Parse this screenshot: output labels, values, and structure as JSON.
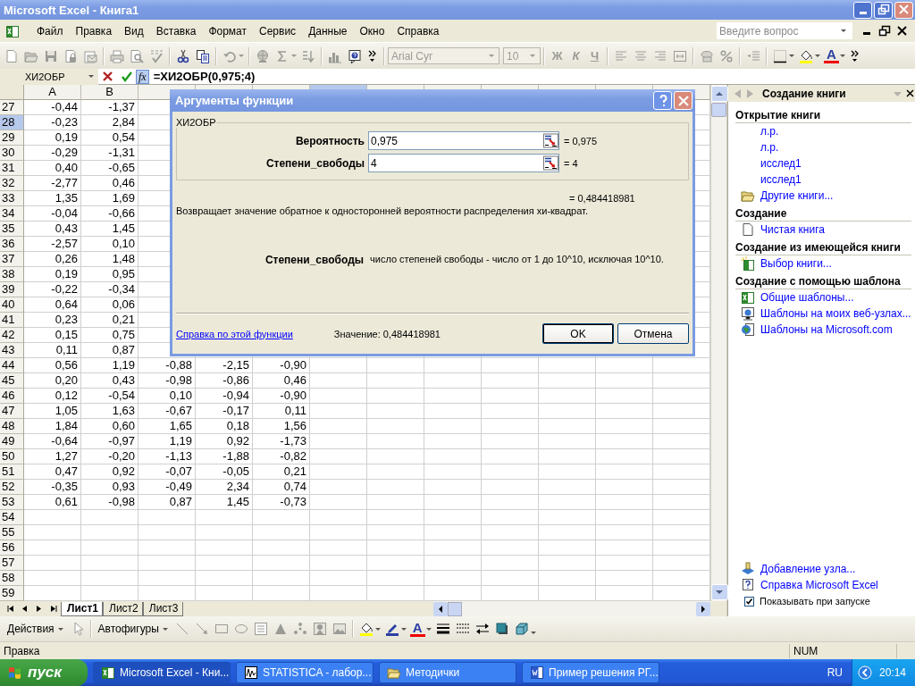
{
  "window": {
    "title": "Microsoft Excel - Книга1"
  },
  "menu": [
    "Файл",
    "Правка",
    "Вид",
    "Вставка",
    "Формат",
    "Сервис",
    "Данные",
    "Окно",
    "Справка"
  ],
  "help_search": {
    "placeholder": "Введите вопрос"
  },
  "formatting": {
    "font": "Arial Cyr",
    "size": "10",
    "style_buttons": [
      "Ж",
      "К",
      "Ч"
    ],
    "font_color": "A"
  },
  "formula_bar": {
    "name_box": "ХИ2ОБР",
    "function_button": "fx",
    "formula": "=ХИ2ОБР(0,975;4)"
  },
  "grid": {
    "columns": [
      {
        "label": "A",
        "selected": false
      },
      {
        "label": "B",
        "selected": false
      },
      {
        "selected": false
      },
      {
        "selected": false
      },
      {
        "selected": false
      },
      {
        "selected": true
      },
      {
        "selected": false
      },
      {
        "selected": false
      },
      {
        "selected": false
      },
      {
        "selected": false
      },
      {
        "selected": false
      },
      {
        "selected": false
      }
    ],
    "rows": [
      {
        "number": "27",
        "selected": false,
        "cells": [
          "-0,44",
          "-1,37"
        ]
      },
      {
        "number": "28",
        "selected": true,
        "cells": [
          "-0,23",
          "2,84"
        ]
      },
      {
        "number": "29",
        "selected": false,
        "cells": [
          "0,19",
          "0,54"
        ]
      },
      {
        "number": "30",
        "selected": false,
        "cells": [
          "-0,29",
          "-1,31"
        ]
      },
      {
        "number": "31",
        "selected": false,
        "cells": [
          "0,40",
          "-0,65"
        ]
      },
      {
        "number": "32",
        "selected": false,
        "cells": [
          "-2,77",
          "0,46"
        ]
      },
      {
        "number": "33",
        "selected": false,
        "cells": [
          "1,35",
          "1,69"
        ]
      },
      {
        "number": "34",
        "selected": false,
        "cells": [
          "-0,04",
          "-0,66"
        ]
      },
      {
        "number": "35",
        "selected": false,
        "cells": [
          "0,43",
          "1,45"
        ]
      },
      {
        "number": "36",
        "selected": false,
        "cells": [
          "-2,57",
          "0,10"
        ]
      },
      {
        "number": "37",
        "selected": false,
        "cells": [
          "0,26",
          "1,48"
        ]
      },
      {
        "number": "38",
        "selected": false,
        "cells": [
          "0,19",
          "0,95"
        ]
      },
      {
        "number": "39",
        "selected": false,
        "cells": [
          "-0,22",
          "-0,34"
        ]
      },
      {
        "number": "40",
        "selected": false,
        "cells": [
          "0,64",
          "0,06"
        ]
      },
      {
        "number": "41",
        "selected": false,
        "cells": [
          "0,23",
          "0,21"
        ]
      },
      {
        "number": "42",
        "selected": false,
        "cells": [
          "0,15",
          "0,75"
        ]
      },
      {
        "number": "43",
        "selected": false,
        "cells": [
          "0,11",
          "0,87"
        ]
      },
      {
        "number": "44",
        "selected": false,
        "cells": [
          "0,56",
          "1,19",
          "-0,88",
          "-2,15",
          "-0,90"
        ]
      },
      {
        "number": "45",
        "selected": false,
        "cells": [
          "0,20",
          "0,43",
          "-0,98",
          "-0,86",
          "0,46"
        ]
      },
      {
        "number": "46",
        "selected": false,
        "cells": [
          "0,12",
          "-0,54",
          "0,10",
          "-0,94",
          "-0,90"
        ]
      },
      {
        "number": "47",
        "selected": false,
        "cells": [
          "1,05",
          "1,63",
          "-0,67",
          "-0,17",
          "0,11"
        ]
      },
      {
        "number": "48",
        "selected": false,
        "cells": [
          "1,84",
          "0,60",
          "1,65",
          "0,18",
          "1,56"
        ]
      },
      {
        "number": "49",
        "selected": false,
        "cells": [
          "-0,64",
          "-0,97",
          "1,19",
          "0,92",
          "-1,73"
        ]
      },
      {
        "number": "50",
        "selected": false,
        "cells": [
          "1,27",
          "-0,20",
          "-1,13",
          "-1,88",
          "-0,82"
        ]
      },
      {
        "number": "51",
        "selected": false,
        "cells": [
          "0,47",
          "0,92",
          "-0,07",
          "-0,05",
          "0,21"
        ]
      },
      {
        "number": "52",
        "selected": false,
        "cells": [
          "-0,35",
          "0,93",
          "-0,49",
          "2,34",
          "0,74"
        ]
      },
      {
        "number": "53",
        "selected": false,
        "cells": [
          "0,61",
          "-0,98",
          "0,87",
          "1,45",
          "-0,73"
        ]
      },
      {
        "number": "54",
        "selected": false,
        "cells": []
      },
      {
        "number": "55",
        "selected": false,
        "cells": []
      },
      {
        "number": "56",
        "selected": false,
        "cells": []
      },
      {
        "number": "57",
        "selected": false,
        "cells": []
      },
      {
        "number": "58",
        "selected": false,
        "cells": []
      },
      {
        "number": "59",
        "selected": false,
        "cells": []
      }
    ]
  },
  "dialog": {
    "title": "Аргументы функции",
    "group": "ХИ2ОБР",
    "arguments": [
      {
        "label": "Вероятность",
        "value": "0,975",
        "result": "= 0,975"
      },
      {
        "label": "Степени_свободы",
        "value": "4",
        "result": "= 4"
      }
    ],
    "result": "= 0,484418981",
    "description": "Возвращает значение обратное к односторонней вероятности распределения хи-квадрат.",
    "argument_help": {
      "label": "Степени_свободы",
      "text": "число степеней свободы - число от 1 до 10^10, исключая 10^10."
    },
    "help_link": "Справка по этой функции",
    "value": "Значение: 0,484418981",
    "buttons": [
      "OK",
      "Отмена"
    ]
  },
  "task_pane": {
    "title": "Создание книги",
    "sections": [
      {
        "heading": "Открытие книги",
        "items": [
          {
            "label": "л.р.",
            "kind": "recent"
          },
          {
            "label": "л.р.",
            "kind": "recent"
          },
          {
            "label": "исслед1",
            "kind": "recent"
          },
          {
            "label": "исслед1",
            "kind": "recent"
          },
          {
            "label": "Другие книги...",
            "kind": "folder"
          }
        ]
      },
      {
        "heading": "Создание",
        "items": [
          {
            "label": "Чистая книга",
            "kind": "blank"
          }
        ]
      },
      {
        "heading": "Создание из имеющейся книги",
        "items": [
          {
            "label": "Выбор книги...",
            "kind": "workbook"
          }
        ]
      },
      {
        "heading": "Создание с помощью шаблона",
        "items": [
          {
            "label": "Общие шаблоны...",
            "kind": "template"
          },
          {
            "label": "Шаблоны на моих веб-узлах...",
            "kind": "web"
          },
          {
            "label": "Шаблоны на Microsoft.com",
            "kind": "globe"
          }
        ]
      }
    ],
    "footer": [
      {
        "label": "Добавление узла...",
        "kind": "site"
      },
      {
        "label": "Справка Microsoft Excel",
        "kind": "help"
      }
    ],
    "show_at_startup": {
      "label": "Показывать при запуске",
      "checked": true
    }
  },
  "sheet_tabs": [
    {
      "label": "Лист1",
      "selected": true
    },
    {
      "label": "Лист2",
      "selected": false
    },
    {
      "label": "Лист3",
      "selected": false
    }
  ],
  "drawing_toolbar": {
    "actions": "Действия",
    "autoshapes": "Автофигуры",
    "font_color": "A"
  },
  "status_bar": {
    "mode": "Правка",
    "indicator": "NUM"
  },
  "taskbar": {
    "start": "пуск",
    "tasks": [
      {
        "label": "Microsoft Excel - Кни...",
        "kind": "excel",
        "selected": true
      },
      {
        "label": "STATISTICA - лабор...",
        "kind": "chart",
        "selected": false
      },
      {
        "label": "Методички",
        "kind": "folder",
        "selected": false
      },
      {
        "label": "Пример решения РГ...",
        "kind": "word",
        "selected": false
      }
    ],
    "language": "RU",
    "clock": "20:14"
  }
}
